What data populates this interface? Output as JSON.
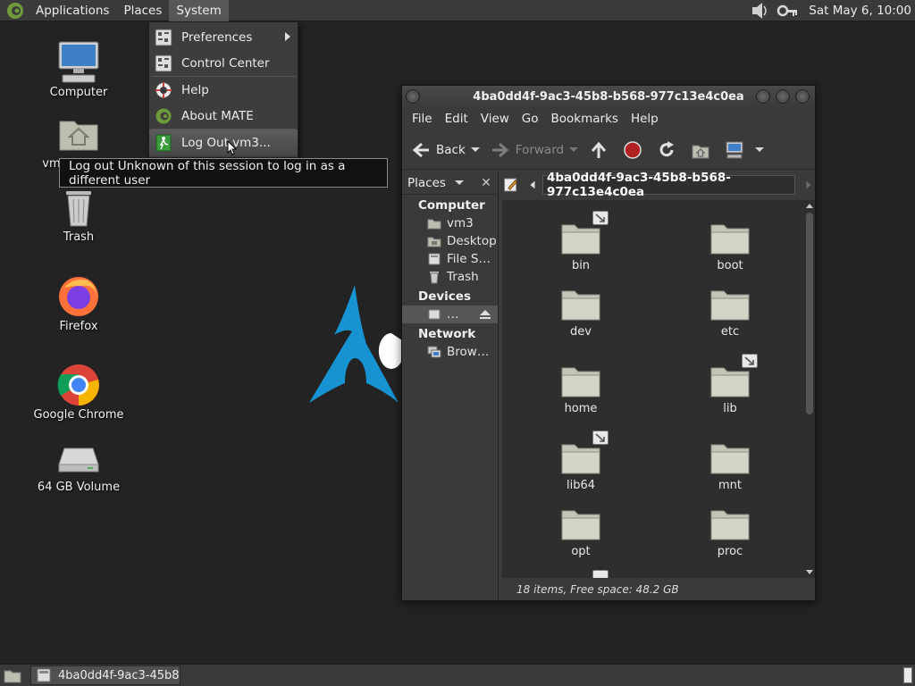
{
  "top_panel": {
    "menus": [
      "Applications",
      "Places",
      "System"
    ],
    "clock": "Sat May  6, 10:00"
  },
  "desktop": {
    "icons": [
      {
        "label": "Computer",
        "icon": "computer-icon"
      },
      {
        "label": "vm3's Home",
        "icon": "home-folder-icon"
      },
      {
        "label": "Trash",
        "icon": "trash-icon"
      },
      {
        "label": "Firefox",
        "icon": "firefox-icon"
      },
      {
        "label": "Google Chrome",
        "icon": "chrome-icon"
      },
      {
        "label": "64 GB Volume",
        "icon": "drive-icon"
      }
    ]
  },
  "system_menu": {
    "items": [
      {
        "label": "Preferences",
        "icon": "preferences-icon",
        "submenu": true
      },
      {
        "label": "Control Center",
        "icon": "control-center-icon"
      },
      {
        "label": "Help",
        "icon": "help-icon"
      },
      {
        "label": "About MATE",
        "icon": "about-icon"
      },
      {
        "label": "Log Out vm3...",
        "icon": "logout-icon",
        "hover": true
      }
    ]
  },
  "tooltip": "Log out Unknown of this session to log in as a different user",
  "file_manager": {
    "title": "4ba0dd4f-9ac3-45b8-b568-977c13e4c0ea",
    "menubar": [
      "File",
      "Edit",
      "View",
      "Go",
      "Bookmarks",
      "Help"
    ],
    "toolbar": {
      "back": "Back",
      "forward": "Forward"
    },
    "side_pane": {
      "selector": "Places",
      "categories": [
        {
          "title": "Computer",
          "items": [
            "vm3",
            "Desktop",
            "File S…",
            "Trash"
          ]
        },
        {
          "title": "Devices",
          "items": [
            "…"
          ]
        },
        {
          "title": "Network",
          "items": [
            "Brow…"
          ]
        }
      ]
    },
    "location": "4ba0dd4f-9ac3-45b8-b568-977c13e4c0ea",
    "files": [
      {
        "name": "bin",
        "link": true
      },
      {
        "name": "boot",
        "link": false
      },
      {
        "name": "dev",
        "link": false
      },
      {
        "name": "etc",
        "link": false
      },
      {
        "name": "home",
        "link": false
      },
      {
        "name": "lib",
        "link": true
      },
      {
        "name": "lib64",
        "link": true
      },
      {
        "name": "mnt",
        "link": false
      },
      {
        "name": "opt",
        "link": false
      },
      {
        "name": "proc",
        "link": false
      }
    ],
    "status": "18 items, Free space: 48.2 GB"
  },
  "taskbar": {
    "task": "4ba0dd4f-9ac3-45b8-…"
  }
}
